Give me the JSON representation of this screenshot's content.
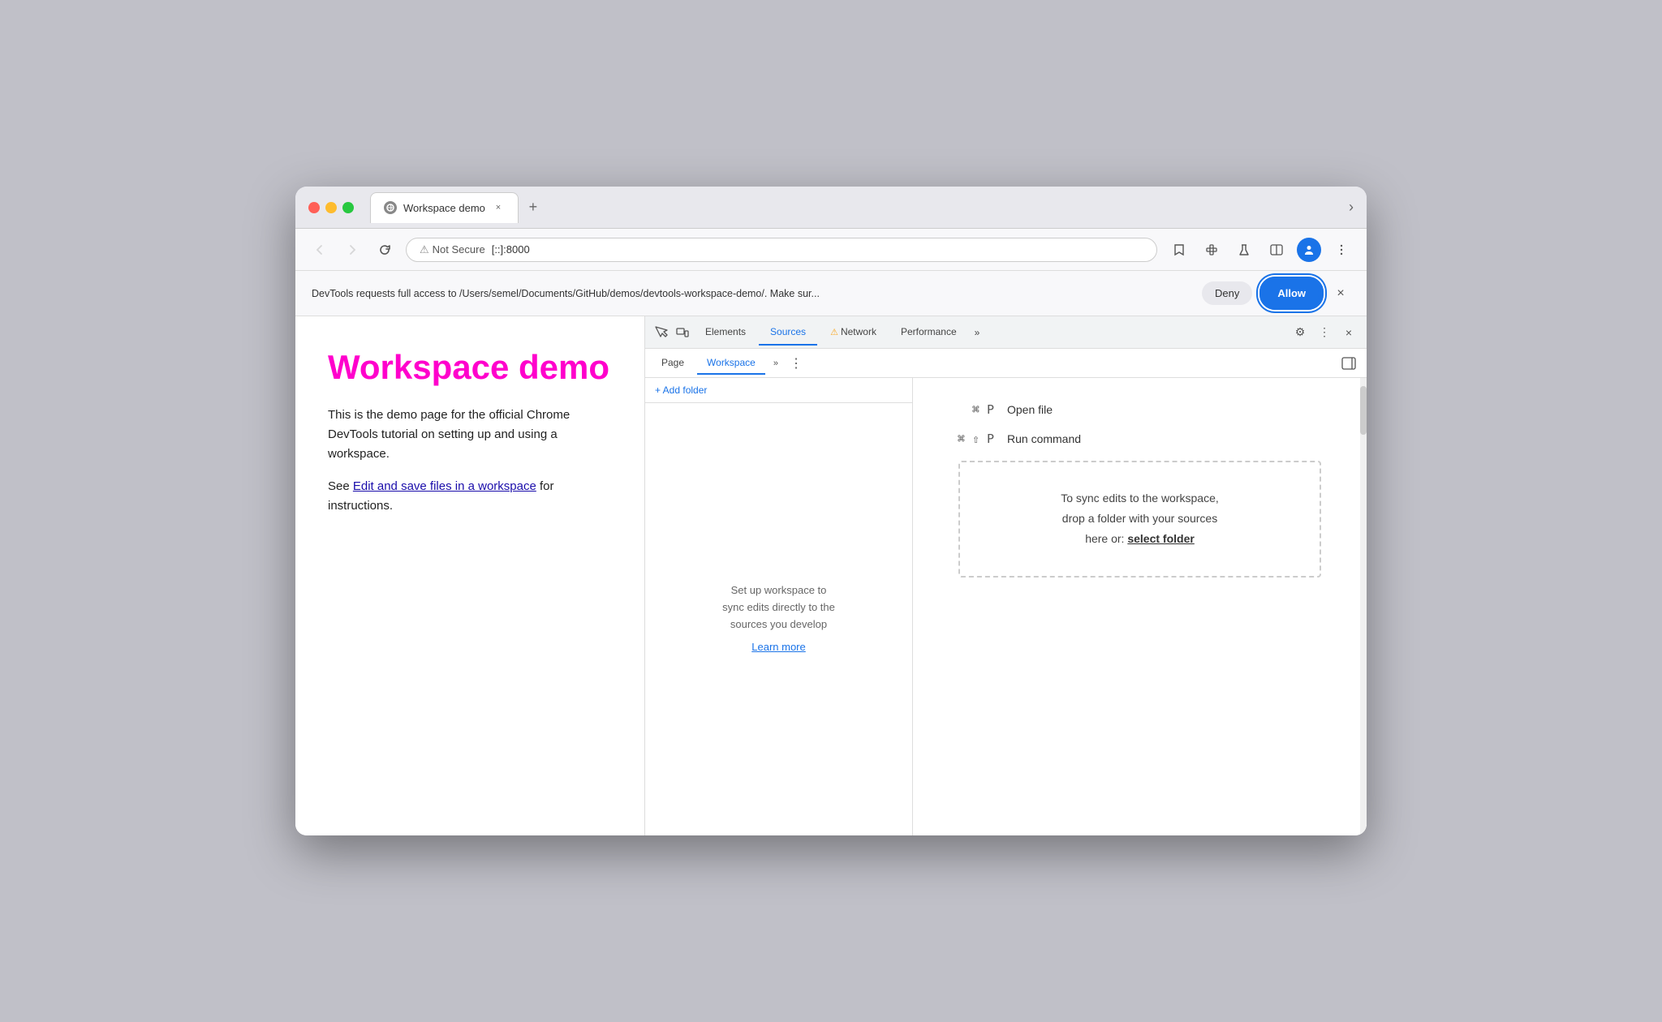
{
  "window": {
    "title": "Workspace demo",
    "tab_close": "×",
    "tab_new": "+"
  },
  "address_bar": {
    "not_secure": "Not Secure",
    "url": "[::]:8000",
    "back_title": "Back",
    "forward_title": "Forward",
    "reload_title": "Reload"
  },
  "permission_banner": {
    "text": "DevTools requests full access to /Users/semel/Documents/GitHub/demos/devtools-workspace-demo/. Make sur...",
    "deny_label": "Deny",
    "allow_label": "Allow"
  },
  "page": {
    "title": "Workspace demo",
    "body1": "This is the demo page for the official Chrome DevTools tutorial on setting up and using a workspace.",
    "body2_prefix": "See ",
    "link_text": "Edit and save files in a workspace",
    "body2_suffix": " for instructions."
  },
  "devtools": {
    "tabs": [
      "Elements",
      "Sources",
      "Network",
      "Performance"
    ],
    "active_tab": "Sources",
    "more_label": "»",
    "settings_label": "⚙",
    "more_dots": "⋮",
    "close_label": "×",
    "sidebar_toggle": "◧",
    "network_warning": "⚠",
    "subtabs": [
      "Page",
      "Workspace"
    ],
    "active_subtab": "Workspace",
    "subtab_more": "»",
    "add_folder_label": "+ Add folder",
    "empty_text_line1": "Set up workspace to",
    "empty_text_line2": "sync edits directly to the",
    "empty_text_line3": "sources you develop",
    "learn_more": "Learn more",
    "shortcut1_keys": "⌘ P",
    "shortcut1_label": "Open file",
    "shortcut2_keys": "⌘ ⇧ P",
    "shortcut2_label": "Run command",
    "drop_zone_line1": "To sync edits to the workspace,",
    "drop_zone_line2": "drop a folder with your sources",
    "drop_zone_line3": "here or: ",
    "drop_zone_link": "select folder"
  }
}
